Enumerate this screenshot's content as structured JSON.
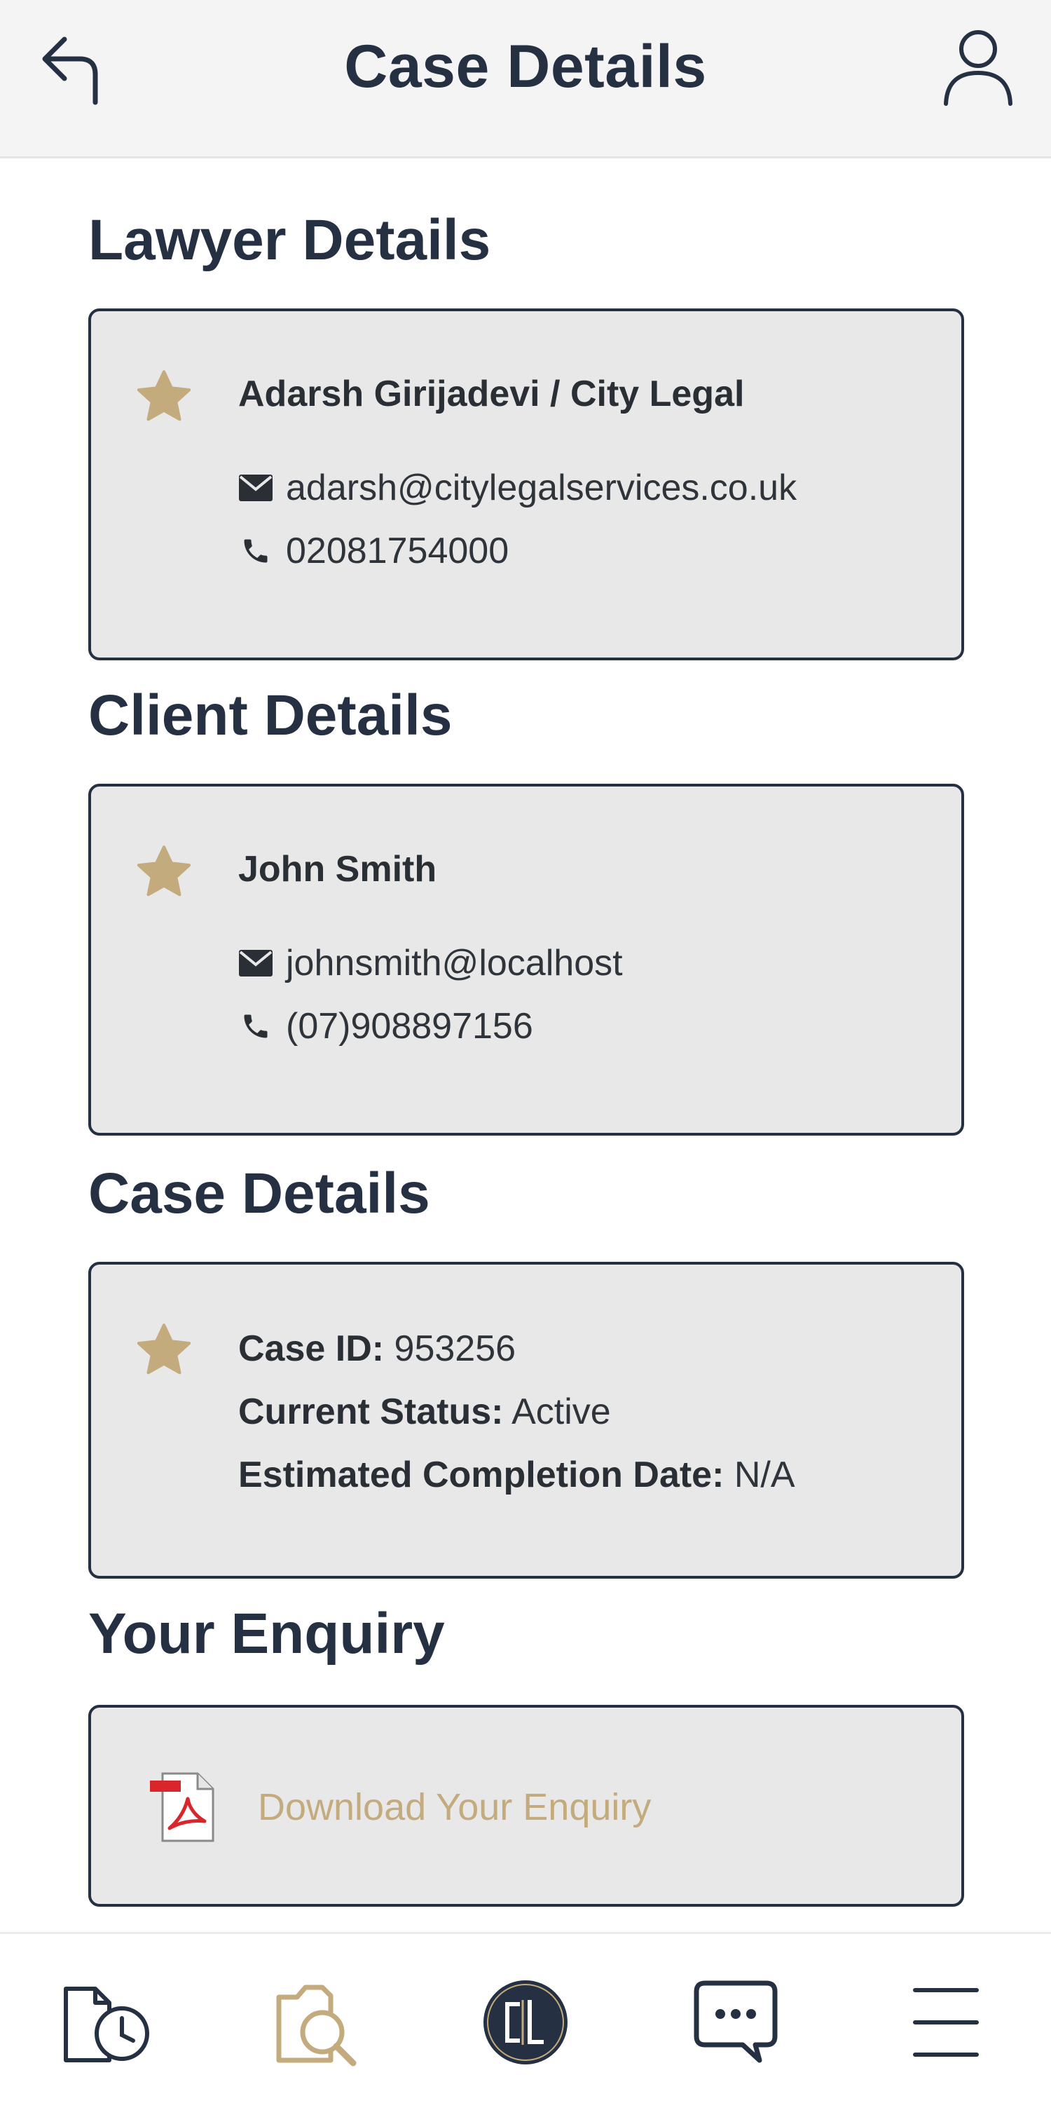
{
  "header": {
    "title": "Case Details",
    "back_icon": "back-arrow-icon",
    "profile_icon": "user-profile-icon"
  },
  "lawyer": {
    "section_title": "Lawyer Details",
    "name": "Adarsh Girijadevi / City Legal",
    "email": "adarsh@citylegalservices.co.uk",
    "phone": "02081754000"
  },
  "client": {
    "section_title": "Client Details",
    "name": "John Smith",
    "email": "johnsmith@localhost",
    "phone": "(07)908897156"
  },
  "case": {
    "section_title": "Case Details",
    "id_label": "Case ID:",
    "id_value": "953256",
    "status_label": "Current Status:",
    "status_value": "Active",
    "completion_label": "Estimated Completion Date:",
    "completion_value": "N/A"
  },
  "enquiry": {
    "section_title": "Your Enquiry",
    "download_label": "Download Your Enquiry"
  },
  "bottom_nav": {
    "items": [
      {
        "icon": "case-history-icon"
      },
      {
        "icon": "case-search-icon"
      },
      {
        "icon": "city-legal-logo-icon"
      },
      {
        "icon": "messages-icon"
      },
      {
        "icon": "menu-icon"
      }
    ]
  },
  "colors": {
    "navy": "#253142",
    "gold": "#c3ab7e",
    "card_bg": "#e8e8e8",
    "header_bg": "#f4f4f4"
  }
}
